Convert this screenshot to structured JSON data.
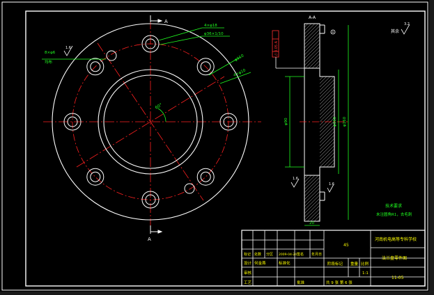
{
  "colors": {
    "background": "#000000",
    "line": "#ffffff",
    "centerline": "#ff2020",
    "dimension": "#20ff20",
    "tolerance": "#ff3030",
    "frame": "#ffffff",
    "title_text": "#ffff00"
  },
  "drawing": {
    "section_marker_top": "A",
    "section_marker_bottom": "A",
    "section_label": "A-A",
    "roughness_corner": "其余",
    "roughness_corner_value": "3.2",
    "roughness_left_value": "1.6",
    "roughness_side_value": "1.6",
    "roughness_face_value": "1.6",
    "datum_ref": "A",
    "angle_label": "60°",
    "callouts": {
      "hole_chamfer": "4×φ18",
      "hole_bore": "φ36×1/10",
      "pcd": "φ110",
      "thread_holes": "4×φ10",
      "left_note_1": "8×φ6",
      "left_note_2": "均布"
    },
    "dims": {
      "inner_diameter": "φ90",
      "outer_diameter": "φ160",
      "body_diameter": "φ160",
      "thickness": "20"
    },
    "tolerance_frame": "// 0.05 A",
    "tech_req_title": "技术要求",
    "tech_req_text": "未注圆角R1，去毛刺"
  },
  "title_block": {
    "school": "河南机电高等专科学校",
    "part_name": "法兰盘零件图",
    "material": "45",
    "scale_label": "比例",
    "scale": "1:1",
    "qty_label": "件数",
    "drawing_no": "11-05",
    "sheet": "共 9 张 第 6 张",
    "row_labels": [
      "标记",
      "处数",
      "分区",
      "更改文件号",
      "签名",
      "年月日"
    ],
    "designer_label": "设计",
    "designer": "何金燕",
    "standard_label": "标准化",
    "audit_label": "审核",
    "process_label": "工艺",
    "approve_label": "批准",
    "stage_label": "阶段标记",
    "weight_label": "重量",
    "date": "2009-04-24"
  }
}
